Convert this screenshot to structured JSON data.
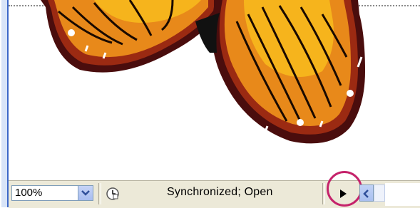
{
  "statusbar": {
    "zoom_value": "100%",
    "status_text": "Synchronized; Open"
  },
  "icons": {
    "zoom_dropdown": "chevron-down-icon",
    "status_menu": "clock-document-icon",
    "status_arrow": "triangle-right-icon",
    "scroll_left": "chevron-left-icon"
  },
  "colors": {
    "wing_dark": "#4a0d0d",
    "wing_orange": "#e8891a",
    "wing_yellow": "#f6b41c",
    "callout": "#c5236b"
  }
}
